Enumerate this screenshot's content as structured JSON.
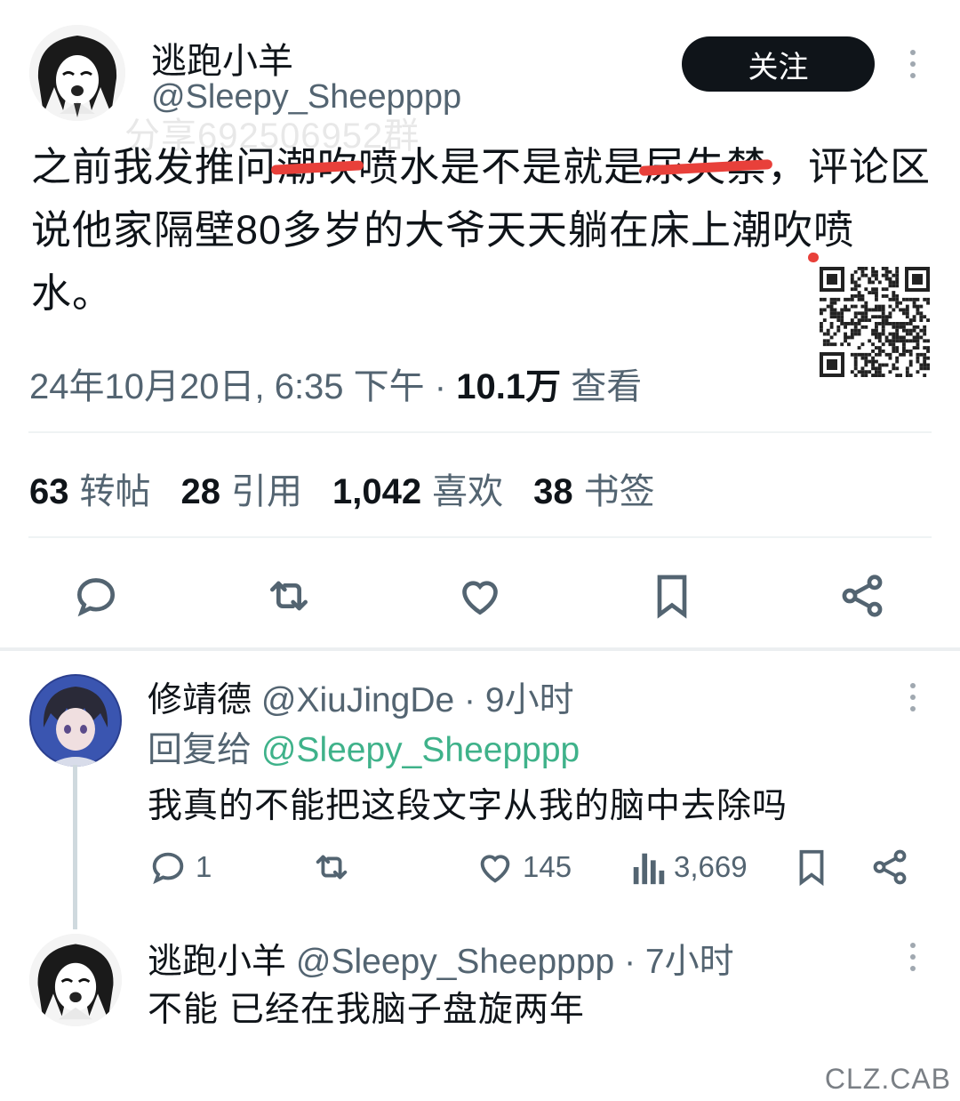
{
  "watermark": "分享692506952群",
  "tweet": {
    "author_name": "逃跑小羊",
    "author_handle": "@Sleepy_Sheepppp",
    "follow_label": "关注",
    "text_parts": [
      "之前我发推问",
      "潮吹",
      "喷水是不是就是",
      "尿失禁",
      "，评论区说他家隔壁80多岁的大爷天天躺在床上潮吹",
      "喷水",
      "。"
    ],
    "timestamp": "24年10月20日, 6:35 下午 · ",
    "views_count": "10.1万",
    "views_label": " 查看",
    "stats": [
      {
        "count": "63",
        "label": "转帖"
      },
      {
        "count": "28",
        "label": "引用"
      },
      {
        "count": "1,042",
        "label": "喜欢"
      },
      {
        "count": "38",
        "label": "书签"
      }
    ],
    "actions": [
      "reply-icon",
      "retweet-icon",
      "like-icon",
      "bookmark-icon",
      "share-icon"
    ]
  },
  "reply1": {
    "name": "修靖德",
    "handle_time": "@XiuJingDe · 9小时",
    "reply_to_label": "回复给 ",
    "reply_to_handle": "@Sleepy_Sheepppp",
    "text": "我真的不能把这段文字从我的脑中去除吗",
    "reply_count": "1",
    "like_count": "145",
    "view_count": "3,669"
  },
  "reply2": {
    "name": "逃跑小羊",
    "handle_time": "@Sleepy_Sheepppp · 7小时",
    "text": "不能 已经在我脑子盘旋两年"
  },
  "corner_watermark": "CLZ.CAB",
  "colors": {
    "accent_green": "#3fb28a",
    "strike_red": "#e8403a",
    "text_primary": "#0f1419",
    "text_muted": "#536471"
  }
}
